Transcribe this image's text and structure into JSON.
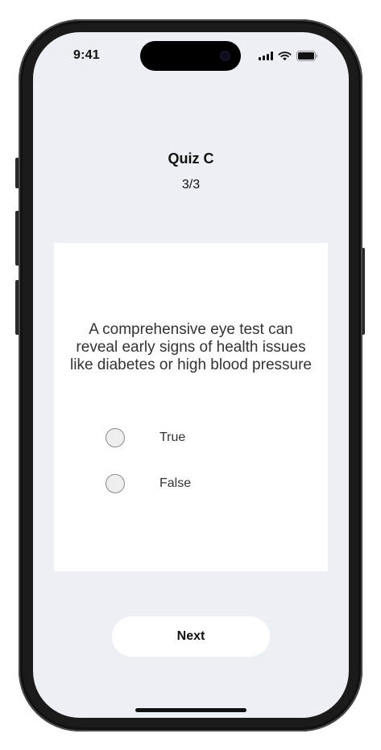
{
  "status_bar": {
    "time": "9:41",
    "icons": [
      "cellular-signal-icon",
      "wifi-icon",
      "battery-icon"
    ]
  },
  "quiz": {
    "title": "Quiz C",
    "progress": "3/3",
    "question": "A comprehensive eye test can reveal early signs of health issues like diabetes or high blood pressure",
    "options": [
      {
        "label": "True",
        "selected": false
      },
      {
        "label": "False",
        "selected": false
      }
    ]
  },
  "actions": {
    "next_label": "Next"
  },
  "colors": {
    "screen_background": "#eceff3",
    "card_background": "#ffffff",
    "button_background": "#ffffff",
    "text_primary": "#111111",
    "text_secondary": "#333333"
  }
}
